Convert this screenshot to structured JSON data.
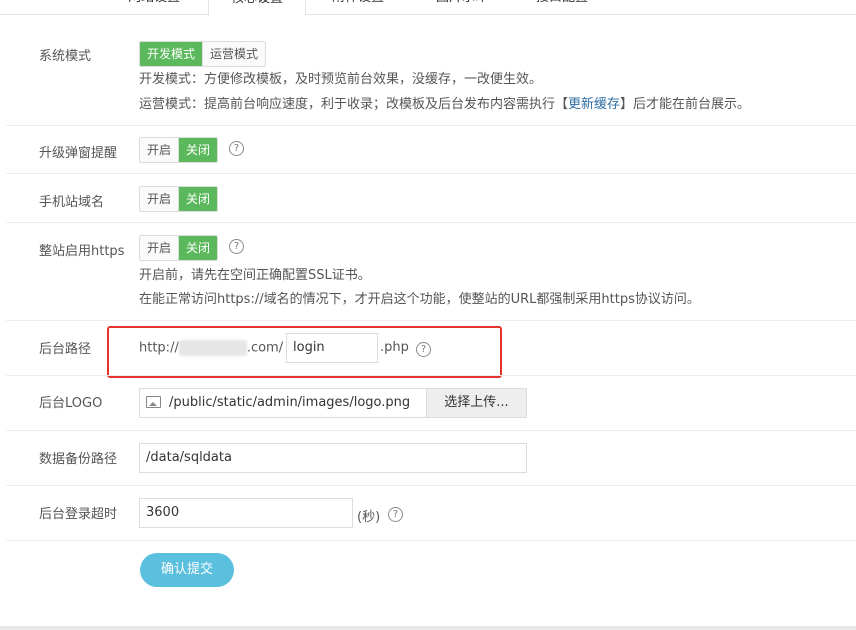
{
  "tabs": [
    "网站设置",
    "核心设置",
    "附件设置",
    "图片水印",
    "接口配置"
  ],
  "system_mode": {
    "label": "系统模式",
    "options": [
      "开发模式",
      "运营模式"
    ],
    "selected": "开发模式",
    "desc1": "开发模式：方便修改模板，及时预览前台效果，没缓存，一改便生效。",
    "desc2_prefix": "运营模式：提高前台响应速度，利于收录；改模板及后台发布内容需执行【",
    "desc2_link": "更新缓存",
    "desc2_suffix": "】后才能在前台展示。"
  },
  "upgrade_popup": {
    "label": "升级弹窗提醒",
    "options": [
      "开启",
      "关闭"
    ],
    "selected": "关闭"
  },
  "mobile_domain": {
    "label": "手机站域名",
    "options": [
      "开启",
      "关闭"
    ],
    "selected": "关闭"
  },
  "https": {
    "label": "整站启用https",
    "options": [
      "开启",
      "关闭"
    ],
    "selected": "关闭",
    "note1": "开启前，请先在空间正确配置SSL证书。",
    "note2": "在能正常访问https://域名的情况下，才开启这个功能，使整站的URL都强制采用https协议访问。"
  },
  "admin_path": {
    "label": "后台路径",
    "prefix": "http://",
    "middle": ".com/",
    "value": "login",
    "suffix": ".php"
  },
  "admin_logo": {
    "label": "后台LOGO",
    "value": "/public/static/admin/images/logo.png",
    "upload_label": "选择上传..."
  },
  "backup_path": {
    "label": "数据备份路径",
    "value": "/data/sqldata"
  },
  "login_timeout": {
    "label": "后台登录超时",
    "value": "3600",
    "unit": "(秒)"
  },
  "help_glyph": "?",
  "submit_label": "确认提交",
  "colors": {
    "accent_green": "#5cb85c",
    "submit_blue": "#5bc0de",
    "highlight_red": "#e5322d",
    "link_blue": "#2e6da4"
  }
}
